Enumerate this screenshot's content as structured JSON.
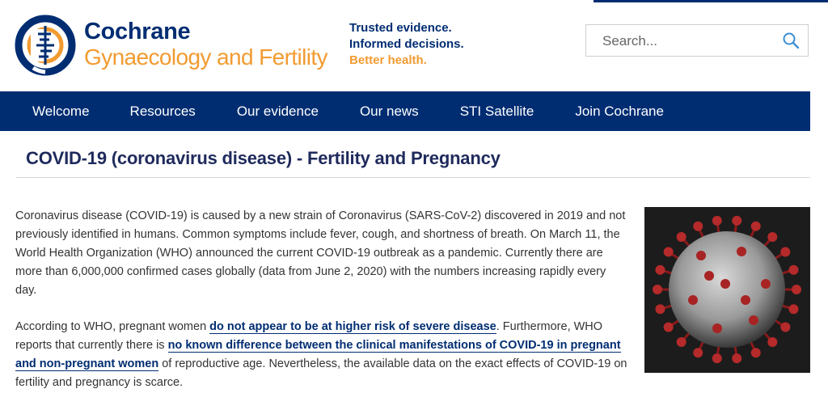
{
  "brand": {
    "name": "Cochrane",
    "group": "Gynaecology and Fertility"
  },
  "tagline": {
    "line1": "Trusted evidence.",
    "line2": "Informed decisions.",
    "line3": "Better health."
  },
  "search": {
    "placeholder": "Search..."
  },
  "nav": {
    "items": [
      "Welcome",
      "Resources",
      "Our evidence",
      "Our news",
      "STI Satellite",
      "Join Cochrane"
    ]
  },
  "page": {
    "title": "COVID-19 (coronavirus disease) - Fertility and Pregnancy"
  },
  "content": {
    "p1": "Coronavirus disease (COVID-19) is caused by a new strain of Coronavirus (SARS-CoV-2) discovered in 2019 and not previously identified in humans. Common symptoms  include fever, cough, and shortness of breath. On March 11, the World Health Organization (WHO) announced the current COVID-19 outbreak as a pandemic. Currently there are more than 6,000,000 confirmed cases globally (data from June 2, 2020) with the numbers increasing rapidly every day.",
    "p2_part1": "According to WHO, pregnant women ",
    "p2_link1": "do not appear to be at higher risk of severe disease",
    "p2_part2": ". Furthermore, WHO reports that currently there is ",
    "p2_link2": "no known difference between the clinical manifestations of COVID-19 in pregnant and non-pregnant women",
    "p2_part3": " of reproductive age. Nevertheless, the available data on the exact effects of COVID-19 on fertility and pregnancy is scarce."
  },
  "colors": {
    "brand_navy": "#002d72",
    "brand_orange": "#f29b31",
    "title_color": "#1f2a5c"
  }
}
